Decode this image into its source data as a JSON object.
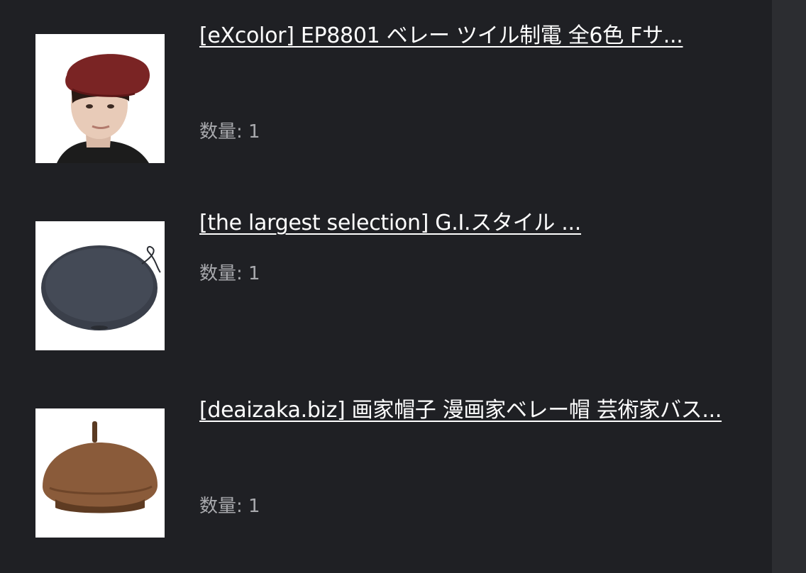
{
  "items": [
    {
      "title": "[eXcolor] EP8801 ベレー ツイル制電 全6色 Fサ...",
      "quantity_label": "数量: 1",
      "image_icon": "maroon-beret-on-mannequin-image"
    },
    {
      "title": "[the largest selection] G.I.スタイル ...",
      "quantity_label": "数量: 1",
      "image_icon": "navy-beret-image"
    },
    {
      "title": "[deaizaka.biz] 画家帽子 漫画家ベレー帽 芸術家バス...",
      "quantity_label": "数量: 1",
      "image_icon": "brown-beret-image"
    }
  ],
  "colors": {
    "background": "#1f2024",
    "scroll_gutter": "#2c2d31",
    "title_text": "#ffffff",
    "quantity_text": "#a8a9ad",
    "thumbnail_background": "#ffffff"
  }
}
